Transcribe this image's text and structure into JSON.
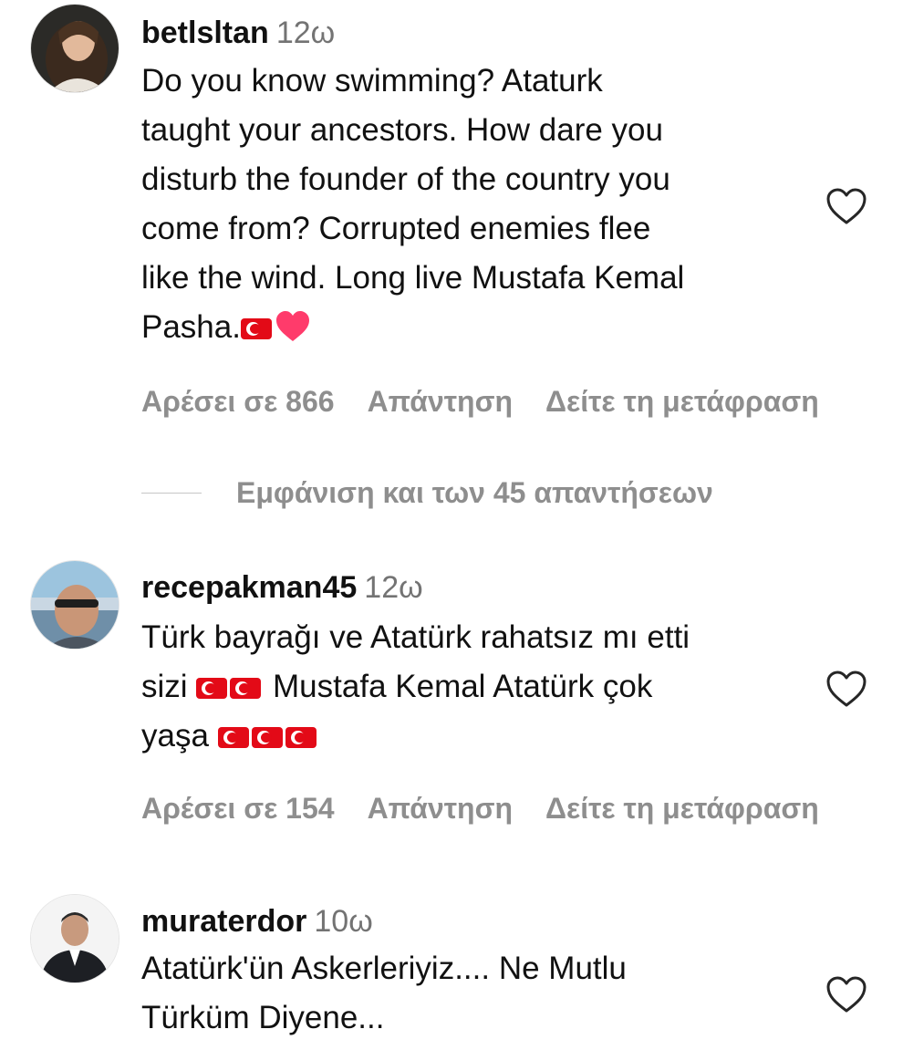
{
  "comments": [
    {
      "username": "betlsltan",
      "time": "12ω",
      "lines": [
        "Do you know swimming? Ataturk",
        "taught your ancestors. How dare you",
        "disturb the founder of the country you",
        "come from? Corrupted enemies flee",
        "like the wind. Long live Mustafa Kemal",
        "Pasha."
      ],
      "likes": "Αρέσει σε 866",
      "reply": "Απάντηση",
      "translate": "Δείτε τη μετάφραση",
      "view_replies": "Εμφάνιση και των 45 απαντήσεων"
    },
    {
      "username": "recepakman45",
      "time": "12ω",
      "lines": [
        "Türk bayrağı ve Atatürk rahatsız mı etti",
        "sizi",
        "Mustafa Kemal Atatürk çok",
        "yaşa"
      ],
      "likes": "Αρέσει σε 154",
      "reply": "Απάντηση",
      "translate": "Δείτε τη μετάφραση"
    },
    {
      "username": "muraterdor",
      "time": "10ω",
      "lines": [
        "Atatürk'ün Askerleriyiz.... Ne Mutlu",
        "Türküm Diyene..."
      ]
    }
  ],
  "colors": {
    "flag": "#e30a17",
    "heart": "#ff3b6b",
    "muted": "#8e8e8e"
  },
  "icons": [
    "avatar",
    "heart-outline-icon",
    "turkish-flag-emoji",
    "red-heart-emoji"
  ]
}
